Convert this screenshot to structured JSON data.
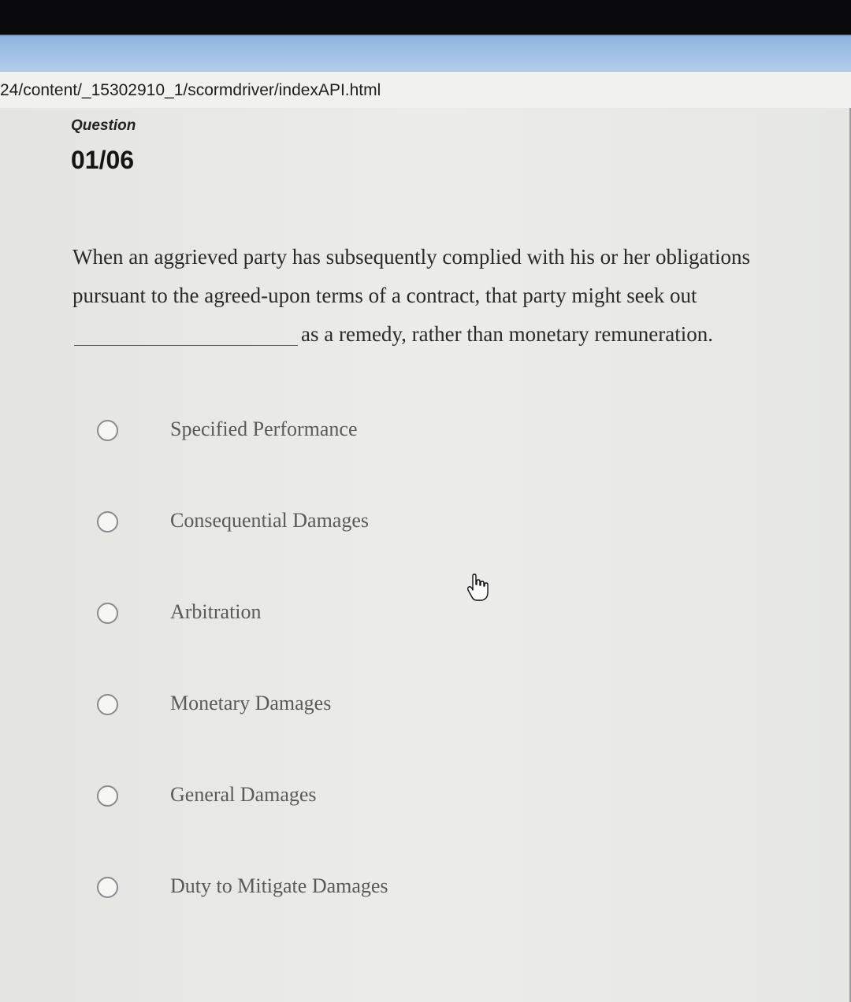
{
  "browser": {
    "url_fragment": "24/content/_15302910_1/scormdriver/indexAPI.html"
  },
  "question": {
    "label": "Question",
    "number": "01/06",
    "prompt_part1": "When an aggrieved party has subsequently complied with his or her obligations pursuant to the agreed-upon terms of a contract, that party might seek out",
    "prompt_part2": "as a remedy, rather than monetary remuneration."
  },
  "options": [
    {
      "label": "Specified Performance"
    },
    {
      "label": "Consequential Damages"
    },
    {
      "label": "Arbitration"
    },
    {
      "label": "Monetary Damages"
    },
    {
      "label": "General Damages"
    },
    {
      "label": "Duty to Mitigate Damages"
    }
  ],
  "cursor_icon": "hand-pointer-icon"
}
